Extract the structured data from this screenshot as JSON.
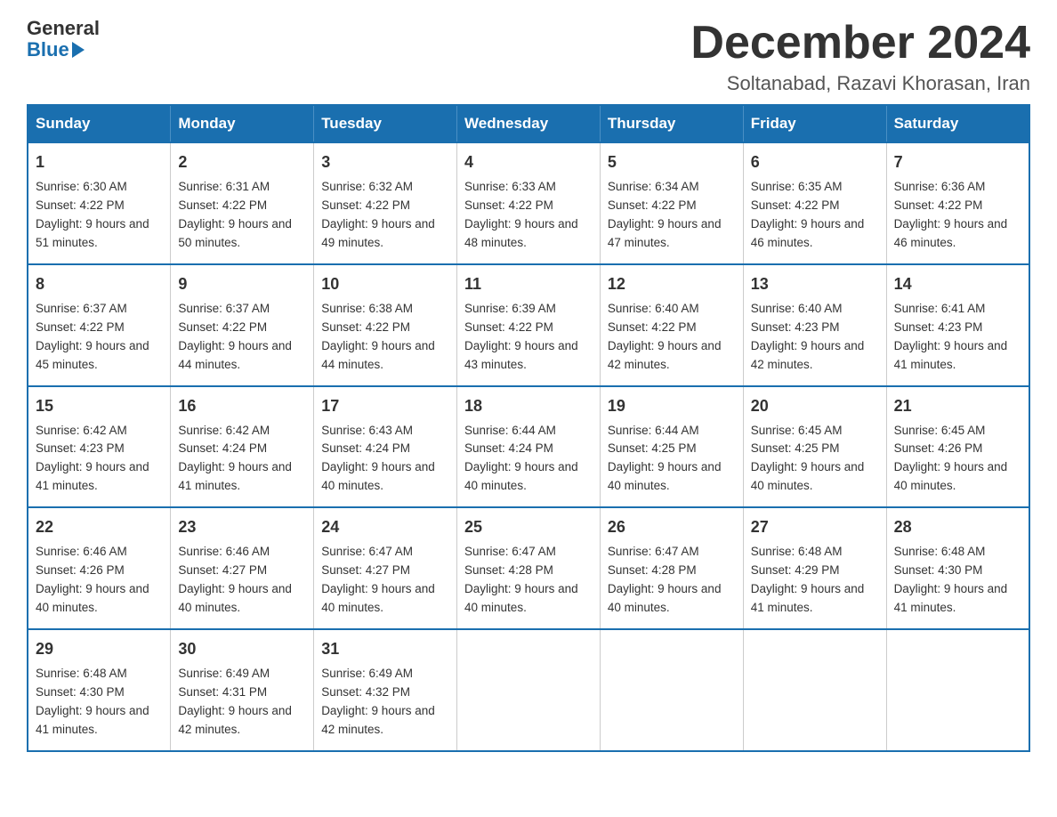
{
  "logo": {
    "general": "General",
    "blue": "Blue"
  },
  "title": "December 2024",
  "location": "Soltanabad, Razavi Khorasan, Iran",
  "weekdays": [
    "Sunday",
    "Monday",
    "Tuesday",
    "Wednesday",
    "Thursday",
    "Friday",
    "Saturday"
  ],
  "weeks": [
    [
      {
        "day": "1",
        "sunrise": "6:30 AM",
        "sunset": "4:22 PM",
        "daylight": "9 hours and 51 minutes."
      },
      {
        "day": "2",
        "sunrise": "6:31 AM",
        "sunset": "4:22 PM",
        "daylight": "9 hours and 50 minutes."
      },
      {
        "day": "3",
        "sunrise": "6:32 AM",
        "sunset": "4:22 PM",
        "daylight": "9 hours and 49 minutes."
      },
      {
        "day": "4",
        "sunrise": "6:33 AM",
        "sunset": "4:22 PM",
        "daylight": "9 hours and 48 minutes."
      },
      {
        "day": "5",
        "sunrise": "6:34 AM",
        "sunset": "4:22 PM",
        "daylight": "9 hours and 47 minutes."
      },
      {
        "day": "6",
        "sunrise": "6:35 AM",
        "sunset": "4:22 PM",
        "daylight": "9 hours and 46 minutes."
      },
      {
        "day": "7",
        "sunrise": "6:36 AM",
        "sunset": "4:22 PM",
        "daylight": "9 hours and 46 minutes."
      }
    ],
    [
      {
        "day": "8",
        "sunrise": "6:37 AM",
        "sunset": "4:22 PM",
        "daylight": "9 hours and 45 minutes."
      },
      {
        "day": "9",
        "sunrise": "6:37 AM",
        "sunset": "4:22 PM",
        "daylight": "9 hours and 44 minutes."
      },
      {
        "day": "10",
        "sunrise": "6:38 AM",
        "sunset": "4:22 PM",
        "daylight": "9 hours and 44 minutes."
      },
      {
        "day": "11",
        "sunrise": "6:39 AM",
        "sunset": "4:22 PM",
        "daylight": "9 hours and 43 minutes."
      },
      {
        "day": "12",
        "sunrise": "6:40 AM",
        "sunset": "4:22 PM",
        "daylight": "9 hours and 42 minutes."
      },
      {
        "day": "13",
        "sunrise": "6:40 AM",
        "sunset": "4:23 PM",
        "daylight": "9 hours and 42 minutes."
      },
      {
        "day": "14",
        "sunrise": "6:41 AM",
        "sunset": "4:23 PM",
        "daylight": "9 hours and 41 minutes."
      }
    ],
    [
      {
        "day": "15",
        "sunrise": "6:42 AM",
        "sunset": "4:23 PM",
        "daylight": "9 hours and 41 minutes."
      },
      {
        "day": "16",
        "sunrise": "6:42 AM",
        "sunset": "4:24 PM",
        "daylight": "9 hours and 41 minutes."
      },
      {
        "day": "17",
        "sunrise": "6:43 AM",
        "sunset": "4:24 PM",
        "daylight": "9 hours and 40 minutes."
      },
      {
        "day": "18",
        "sunrise": "6:44 AM",
        "sunset": "4:24 PM",
        "daylight": "9 hours and 40 minutes."
      },
      {
        "day": "19",
        "sunrise": "6:44 AM",
        "sunset": "4:25 PM",
        "daylight": "9 hours and 40 minutes."
      },
      {
        "day": "20",
        "sunrise": "6:45 AM",
        "sunset": "4:25 PM",
        "daylight": "9 hours and 40 minutes."
      },
      {
        "day": "21",
        "sunrise": "6:45 AM",
        "sunset": "4:26 PM",
        "daylight": "9 hours and 40 minutes."
      }
    ],
    [
      {
        "day": "22",
        "sunrise": "6:46 AM",
        "sunset": "4:26 PM",
        "daylight": "9 hours and 40 minutes."
      },
      {
        "day": "23",
        "sunrise": "6:46 AM",
        "sunset": "4:27 PM",
        "daylight": "9 hours and 40 minutes."
      },
      {
        "day": "24",
        "sunrise": "6:47 AM",
        "sunset": "4:27 PM",
        "daylight": "9 hours and 40 minutes."
      },
      {
        "day": "25",
        "sunrise": "6:47 AM",
        "sunset": "4:28 PM",
        "daylight": "9 hours and 40 minutes."
      },
      {
        "day": "26",
        "sunrise": "6:47 AM",
        "sunset": "4:28 PM",
        "daylight": "9 hours and 40 minutes."
      },
      {
        "day": "27",
        "sunrise": "6:48 AM",
        "sunset": "4:29 PM",
        "daylight": "9 hours and 41 minutes."
      },
      {
        "day": "28",
        "sunrise": "6:48 AM",
        "sunset": "4:30 PM",
        "daylight": "9 hours and 41 minutes."
      }
    ],
    [
      {
        "day": "29",
        "sunrise": "6:48 AM",
        "sunset": "4:30 PM",
        "daylight": "9 hours and 41 minutes."
      },
      {
        "day": "30",
        "sunrise": "6:49 AM",
        "sunset": "4:31 PM",
        "daylight": "9 hours and 42 minutes."
      },
      {
        "day": "31",
        "sunrise": "6:49 AM",
        "sunset": "4:32 PM",
        "daylight": "9 hours and 42 minutes."
      },
      null,
      null,
      null,
      null
    ]
  ]
}
